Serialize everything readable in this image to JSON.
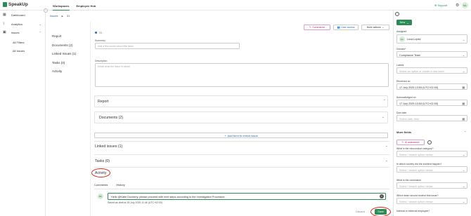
{
  "app": {
    "name": "SpeakUp"
  },
  "topnav": {
    "workspaces": "Workspaces",
    "employee_hub": "Employee Hub"
  },
  "topright": {
    "support": "Support",
    "avatar_initials": "LL"
  },
  "sidebar": {
    "items": [
      {
        "label": "Dashboard"
      },
      {
        "label": "Analytics"
      },
      {
        "label": "Issues"
      }
    ],
    "sub_items": [
      "All Filters",
      "All Issues"
    ]
  },
  "breadcrumb": {
    "parent": "Issues",
    "separator": "▶",
    "current": "31"
  },
  "issue_nav": {
    "items": [
      "Report",
      "Documents (2)",
      "Linked Issues (1)",
      "Tasks (0)",
      "Activity"
    ]
  },
  "header_actions": {
    "summarize": "Summarize",
    "user_access": "User access",
    "more_actions": "More actions"
  },
  "issue": {
    "number": "31",
    "summary_label": "Summary",
    "summary_placeholder": "Add a few words about this issue",
    "description_label": "Description",
    "description_placeholder": "Detail what the issue is about."
  },
  "sections": {
    "report": "Report",
    "documents": "Documents (2)",
    "add_form": "Add form to enrich issue",
    "linked_issues": "Linked issues (1)",
    "tasks": "Tasks (0)",
    "activity": "Activity"
  },
  "activity": {
    "tabs": [
      "Comments",
      "History"
    ],
    "avatar_initials": "LL",
    "comment_text": "Hello @Katie Docherty, please proceed with next steps according to the Investigation Procedure.",
    "saved_note": "Saved as draft at 18 July 2025 11:46 (UTC+02:00)",
    "discard": "Discard",
    "save": "Save"
  },
  "right_panel": {
    "new_button": "New",
    "assignee_label": "Assignee",
    "assignee_initials": "LL",
    "assignee_value": "Luca Lopez",
    "domain_label": "Domain*",
    "domain_value": "Compliance Team",
    "labels_label": "Labels",
    "labels_placeholder": "Select an option or create a new label",
    "received_label": "Received on",
    "received_value": "17 July 2025 13:53 (UTC+02:00)",
    "ack_label": "Acknowledged on",
    "ack_value": "17 July 2025 13:53 (UTC+02:00)",
    "due_label": "Due date",
    "due_placeholder": "Select date, time",
    "more_fields": "More fields",
    "ai_assistance": "AI assistance",
    "q1_label": "What is the misconduct category?",
    "q1_placeholder": "Select / search option below",
    "q2_label": "In which country did the incident happen?",
    "q2_placeholder": "Select / search option below",
    "q3_label": "What is the conclusion",
    "q3_placeholder": "Select / search option below",
    "q4_label": "Which team should receive this issue?",
    "q4_placeholder": "Select / search option below",
    "q5_label": "Internal or external employee?"
  }
}
